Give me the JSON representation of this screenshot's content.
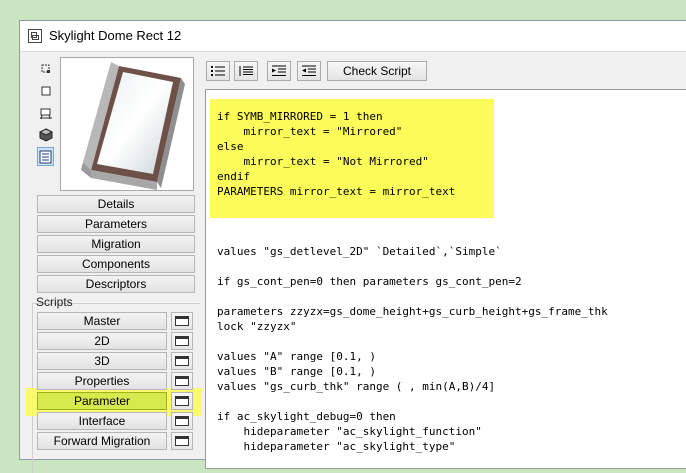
{
  "window": {
    "title": "Skylight Dome Rect 12"
  },
  "view_icons": [
    {
      "name": "2d-symbol-icon",
      "active": false
    },
    {
      "name": "2d-window-icon",
      "active": false
    },
    {
      "name": "plan-table-icon",
      "active": false
    },
    {
      "name": "3d-cube-icon",
      "active": false
    },
    {
      "name": "list-view-icon",
      "active": true
    }
  ],
  "nav_buttons": [
    "Details",
    "Parameters",
    "Migration",
    "Components",
    "Descriptors"
  ],
  "scripts_label": "Scripts",
  "script_buttons": [
    {
      "label": "Master",
      "selected": false
    },
    {
      "label": "2D",
      "selected": false
    },
    {
      "label": "3D",
      "selected": false
    },
    {
      "label": "Properties",
      "selected": false
    },
    {
      "label": "Parameter",
      "selected": true
    },
    {
      "label": "Interface",
      "selected": false
    },
    {
      "label": "Forward Migration",
      "selected": false
    }
  ],
  "toolbar": {
    "icons": [
      "list-bullets-icon",
      "list-lines-icon",
      "indent-icon",
      "outdent-icon"
    ],
    "check_script_label": "Check Script"
  },
  "code_lines": [
    "if SYMB_MIRRORED = 1 then",
    "    mirror_text = \"Mirrored\"",
    "else",
    "    mirror_text = \"Not Mirrored\"",
    "endif",
    "PARAMETERS mirror_text = mirror_text",
    "",
    "",
    "",
    "values \"gs_detlevel_2D\" `Detailed`,`Simple`",
    "",
    "if gs_cont_pen=0 then parameters gs_cont_pen=2",
    "",
    "parameters zzyzx=gs_dome_height+gs_curb_height+gs_frame_thk",
    "lock \"zzyzx\"",
    "",
    "values \"A\" range [0.1, )",
    "values \"B\" range [0.1, )",
    "values \"gs_curb_thk\" range ( , min(A,B)/4]",
    "",
    "if ac_skylight_debug=0 then",
    "    hideparameter \"ac_skylight_function\"",
    "    hideparameter \"ac_skylight_type\""
  ],
  "colors": {
    "highlight": "#fbfb59",
    "selected_script": "#d7ea4d",
    "desktop": "#c9e6c0"
  }
}
